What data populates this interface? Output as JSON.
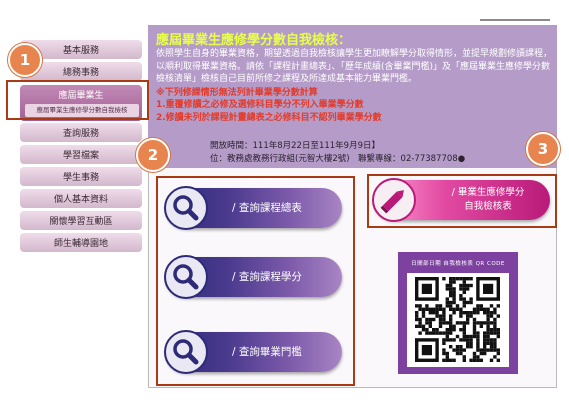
{
  "sidebar": {
    "items_before": [
      "基本服務",
      "總務事務"
    ],
    "active": {
      "label": "應屆畢業生",
      "sub": "應屆畢業生應修學分數自我檢核"
    },
    "items_after": [
      "查詢服務",
      "學習檔案",
      "學生事務",
      "個人基本資料",
      "關懷學習互動區",
      "師生輔導園地"
    ]
  },
  "header": {
    "title": "應屆畢業生應修學分數自我檢核：",
    "paragraph": "依照學生自身的畢業資格，期望透過自我檢核讓學生更加瞭解學分取得情形，並提早規劃修讀課程，以順利取得畢業資格。請依「課程計畫總表」、「歷年成績(含畢業門檻)」及「應屆畢業生應修學分數檢核清單」檢核自己目前所修之課程及所達成基本能力畢業門檻。",
    "warn_title": "※下列修課情形無法列計畢業學分數計算",
    "warn_1": "1.重覆修讀之必修及選修科目學分不列入畢業學分數",
    "warn_2": "2.修讀未列於課程計畫總表之必修科目不認列畢業學分數",
    "period": "開放時間：111年8月22日至111年9月9日】",
    "unit": "位：教務處教務行政組(元智大樓2號)　聯繫專線：02-77387708●"
  },
  "buttons": {
    "curriculum": "/ 查詢課程總表",
    "credits": "/ 查詢課程學分",
    "threshold": "/ 查詢畢業門檻",
    "selfcheck_line1": "/ 畢業生應修學分",
    "selfcheck_line2": "自我檢核表"
  },
  "qr": {
    "caption": "日間部日期 自我檢核表 QR CODE"
  },
  "callouts": [
    "1",
    "2",
    "3"
  ],
  "colors": {
    "header_bg": "#b59cc8",
    "title": "#e8ff4a",
    "warn": "#e33a2a",
    "query_btn": "#2e2a78",
    "check_btn": "#e24aa2",
    "qr_bg": "#7d41a0",
    "callout": "#e8854e",
    "highlight": "#a83a14"
  }
}
